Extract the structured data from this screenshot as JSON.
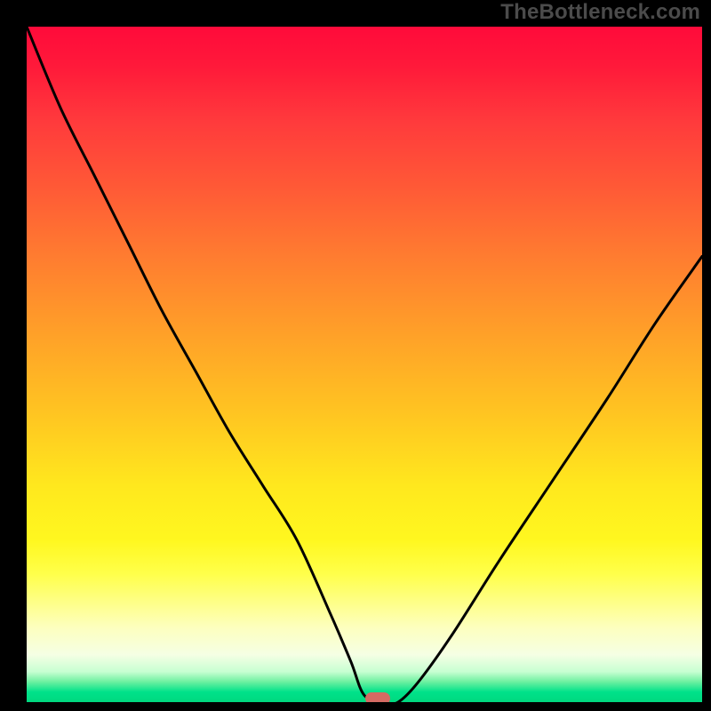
{
  "watermark": "TheBottleneck.com",
  "colors": {
    "page_bg": "#000000",
    "curve_stroke": "#000000",
    "marker_fill": "#d46a63",
    "watermark_text": "#4b4b4b",
    "gradient_top": "#ff0a3a",
    "gradient_mid": "#ffe81e",
    "gradient_bottom": "#00d87f"
  },
  "chart_data": {
    "type": "line",
    "title": "",
    "xlabel": "",
    "ylabel": "",
    "xlim": [
      0,
      100
    ],
    "ylim": [
      0,
      100
    ],
    "grid": false,
    "legend": false,
    "background": "vertical-heat-gradient",
    "curve_description": "V-shaped bottleneck curve: steep descent from top-left, minimum plateau near x≈50–55, then rises toward upper right",
    "x": [
      0,
      5,
      10,
      15,
      20,
      25,
      30,
      35,
      40,
      45,
      48,
      50,
      53,
      55,
      58,
      63,
      70,
      78,
      86,
      93,
      100
    ],
    "values": [
      100,
      88,
      78,
      68,
      58,
      49,
      40,
      32,
      24,
      13,
      6,
      1,
      0,
      0,
      3,
      10,
      21,
      33,
      45,
      56,
      66
    ],
    "marker": {
      "x": 52,
      "y": 0,
      "shape": "rounded-rect"
    }
  }
}
